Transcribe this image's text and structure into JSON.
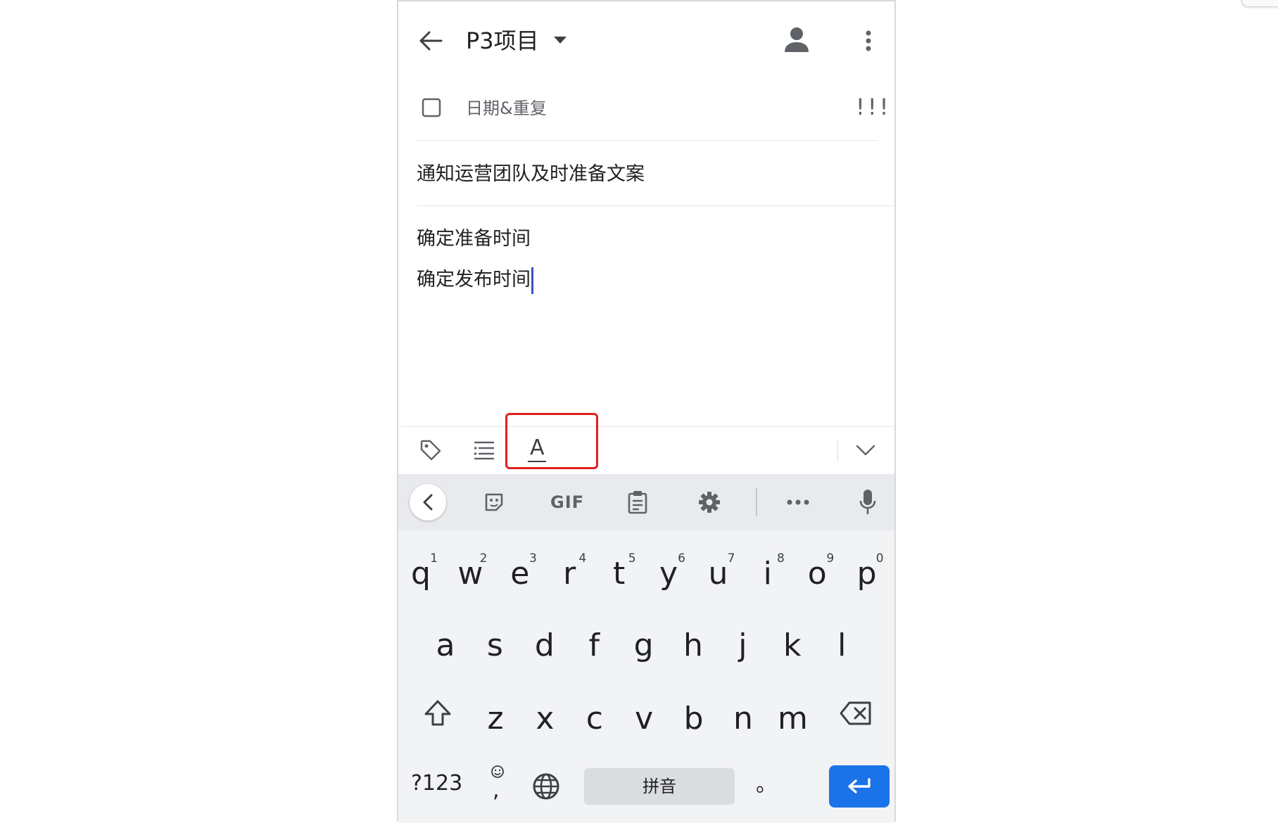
{
  "header": {
    "title": "P3项目",
    "back_icon": "arrow-left-icon",
    "dropdown_icon": "caret-down-icon",
    "assignee_icon": "person-icon",
    "more_icon": "more-vertical-icon"
  },
  "task": {
    "checkbox_icon": "checkbox-icon",
    "date_repeat_label": "日期&重复",
    "priority_label": "!!!",
    "title": "通知运营团队及时准备文案",
    "notes": [
      "确定准备时间",
      "确定发布时间"
    ]
  },
  "edit_toolbar": {
    "tag_icon": "tag-icon",
    "list_icon": "list-icon",
    "text_format_icon": "text-format-icon",
    "text_format_glyph": "A",
    "collapse_icon": "chevron-down-icon"
  },
  "keyboard_toolbar": {
    "back_icon": "chevron-left-icon",
    "sticker_icon": "sticker-icon",
    "gif_label": "GIF",
    "clipboard_icon": "clipboard-icon",
    "settings_icon": "gear-icon",
    "more_icon": "more-horizontal-icon",
    "mic_icon": "microphone-icon"
  },
  "keyboard": {
    "row1": [
      {
        "key": "q",
        "hint": "1"
      },
      {
        "key": "w",
        "hint": "2"
      },
      {
        "key": "e",
        "hint": "3"
      },
      {
        "key": "r",
        "hint": "4"
      },
      {
        "key": "t",
        "hint": "5"
      },
      {
        "key": "y",
        "hint": "6"
      },
      {
        "key": "u",
        "hint": "7"
      },
      {
        "key": "i",
        "hint": "8"
      },
      {
        "key": "o",
        "hint": "9"
      },
      {
        "key": "p",
        "hint": "0"
      }
    ],
    "row2": [
      "a",
      "s",
      "d",
      "f",
      "g",
      "h",
      "j",
      "k",
      "l"
    ],
    "row3": [
      "z",
      "x",
      "c",
      "v",
      "b",
      "n",
      "m"
    ],
    "shift_icon": "shift-icon",
    "backspace_icon": "backspace-icon",
    "symbols_label": "?123",
    "emoji_icon": "emoji-icon",
    "comma_label": ",",
    "globe_icon": "globe-icon",
    "space_label": "拼音",
    "period_label": "。",
    "enter_icon": "enter-icon"
  },
  "colors": {
    "enter_key": "#1a73e8",
    "highlight": "#e0201c",
    "cursor": "#3c4fc4"
  }
}
